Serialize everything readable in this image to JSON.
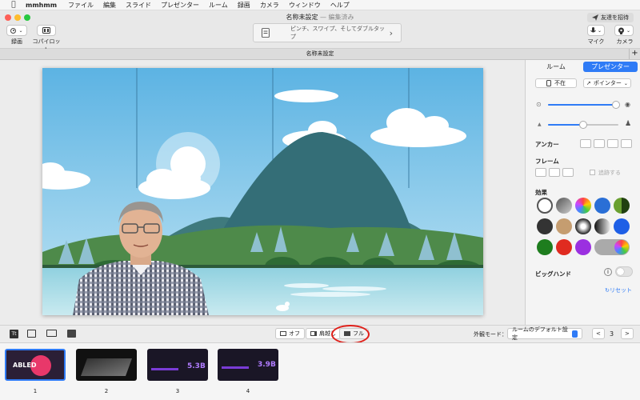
{
  "menubar": {
    "app_name": "mmhmm",
    "items": [
      "ファイル",
      "編集",
      "スライド",
      "プレゼンター",
      "ルーム",
      "録画",
      "カメラ",
      "ウィンドウ",
      "ヘルプ"
    ]
  },
  "window": {
    "title": "名称未設定",
    "title_separator": "—",
    "edited": "編集済み"
  },
  "toolbar": {
    "record_label": "録画",
    "copilot_label": "コパイロット",
    "hint_text": "ピンチ、スワイプ、そしてダブルタップ",
    "invite_label": "友達を招待",
    "mic_label": "マイク",
    "camera_label": "カメラ"
  },
  "tabbar": {
    "doc_title": "名称未設定",
    "plus": "+"
  },
  "sidebar": {
    "tabs": [
      "ルーム",
      "プレゼンター"
    ],
    "away_label": "不在",
    "pointer_label": "ポインター",
    "anchor_label": "アンカー",
    "frame_label": "フレーム",
    "follow_label": "追跡する",
    "effects_label": "効果",
    "big_hands_label": "ビッグハンド",
    "info": "i",
    "reset_label": "リセット",
    "opacity_level": 0.97,
    "size_level": 0.5,
    "accent": "#2f7bf6",
    "effect_colors": [
      "#1e7d1e",
      "#e02b20",
      "#9b30e0"
    ]
  },
  "bottombar": {
    "off_label": "オフ",
    "over_shoulder_label": "肩越し",
    "full_label": "フル",
    "appearance_mode_label": "外観モード：",
    "appearance_mode_value": "ルームのデフォルト設定",
    "page_number": "3",
    "prev": "<",
    "next": ">"
  },
  "slides": [
    {
      "number": "1",
      "thumb_text": "ABLED"
    },
    {
      "number": "2",
      "thumb_text": ""
    },
    {
      "number": "3",
      "thumb_text": "5.3",
      "thumb_unit": "B"
    },
    {
      "number": "4",
      "thumb_text": "3.9",
      "thumb_unit": "B"
    }
  ],
  "colors": {
    "highlight_circle": "#e0201a",
    "selected_thumb": "#2f7bf6"
  }
}
